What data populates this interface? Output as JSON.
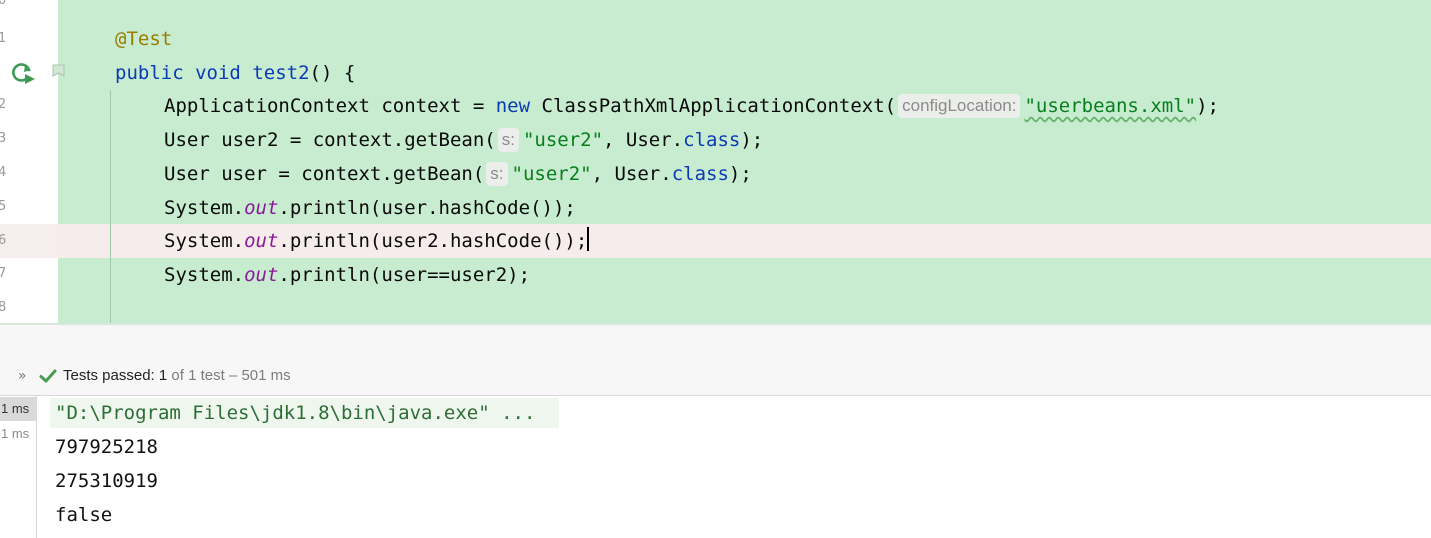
{
  "editor": {
    "line_numbers": [
      "0",
      "1",
      "2",
      "3",
      "4",
      "5",
      "6",
      "7",
      "8"
    ],
    "code": {
      "annotation": "@Test",
      "method_sig": {
        "kw1": "public",
        "kw2": "void",
        "name": "test2",
        "rest": "() {"
      },
      "line_context": {
        "pre": "ApplicationContext context = ",
        "new_kw": "new",
        "cls": " ClassPathXmlApplicationContext(",
        "hint": "configLocation:",
        "str": "\"userbeans.xml\"",
        "post": ");"
      },
      "line_user2": {
        "pre": "User user2 = context.getBean(",
        "hint": "s:",
        "str": "\"user2\"",
        "mid": ", User.",
        "class_kw": "class",
        "post": ");"
      },
      "line_user": {
        "pre": "User user = context.getBean(",
        "hint": "s:",
        "str": "\"user2\"",
        "mid": ", User.",
        "class_kw": "class",
        "post": ");"
      },
      "print1": {
        "pre": "System.",
        "field": "out",
        "post": ".println(user.hashCode());"
      },
      "print2": {
        "pre": "System.",
        "field": "out",
        "post": ".println(user2.hashCode());"
      },
      "print3": {
        "pre": "System.",
        "field": "out",
        "post": ".println(user==user2);"
      }
    },
    "colors": {
      "covered_bg": "#c7ecd0",
      "caret_line_bg": "#f6ecec",
      "keyword": "#0a3bb5",
      "string": "#087e1c"
    }
  },
  "run": {
    "chevron": "»",
    "status_label": "Tests passed:",
    "passed_count": "1",
    "status_detail": "of 1 test – 501 ms",
    "tree_items": [
      "1 ms",
      "1 ms"
    ],
    "console": {
      "command": "\"D:\\Program Files\\jdk1.8\\bin\\java.exe\" ...",
      "outputs": [
        "797925218",
        "275310919",
        "false"
      ]
    },
    "icons": {
      "run": "rerun-test-icon",
      "bookmark": "bookmark-icon",
      "status": "check-icon"
    }
  }
}
